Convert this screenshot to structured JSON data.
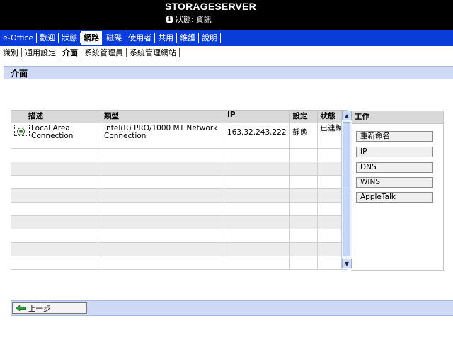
{
  "header": {
    "server_name": "STORAGESERVER",
    "status_label": "狀態:",
    "status_value": "資訊",
    "status_icon": "info-icon"
  },
  "nav": {
    "items": [
      {
        "label": "e-Office",
        "active": false
      },
      {
        "label": "歡迎",
        "active": false
      },
      {
        "label": "狀態",
        "active": false
      },
      {
        "label": "網路",
        "active": true
      },
      {
        "label": "磁碟",
        "active": false
      },
      {
        "label": "使用者",
        "active": false
      },
      {
        "label": "共用",
        "active": false
      },
      {
        "label": "維護",
        "active": false
      },
      {
        "label": "說明",
        "active": false
      }
    ]
  },
  "subnav": {
    "items": [
      {
        "label": "識別",
        "active": false
      },
      {
        "label": "通用設定",
        "active": false
      },
      {
        "label": "介面",
        "active": true
      },
      {
        "label": "系統管理員",
        "active": false
      },
      {
        "label": "系統管理網站",
        "active": false
      }
    ]
  },
  "page_title": "介面",
  "table": {
    "columns": [
      "描述",
      "類型",
      "IP",
      "設定",
      "狀態"
    ],
    "rows": [
      {
        "description": "Local Area Connection",
        "type": "Intel(R) PRO/1000 MT Network Connection",
        "ip": "163.32.243.222",
        "setting": "靜態",
        "status": "已連線",
        "selected": true
      }
    ]
  },
  "tasks": {
    "title": "工作",
    "items": [
      "重新命名",
      "IP",
      "DNS",
      "WINS",
      "AppleTalk"
    ]
  },
  "footer": {
    "back_label": "上一步"
  },
  "colors": {
    "topbar": "#000000",
    "navbar": "#0a3dd8",
    "section_bar": "#cdd9f5",
    "header_row": "#d9d9d9"
  }
}
